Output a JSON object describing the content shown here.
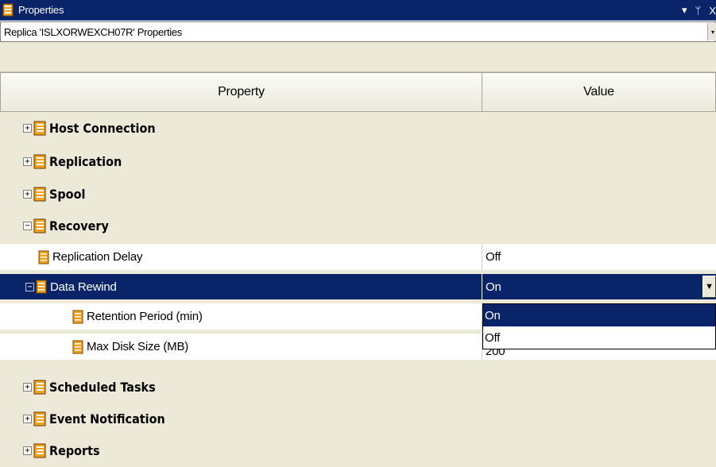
{
  "window": {
    "title": "Properties",
    "controls": {
      "dropdown": "▾",
      "pin": "ᛘ",
      "close": "X"
    }
  },
  "object_selector": {
    "value": "Replica  'ISLXORWEXCH07R' Properties",
    "arrow": "▾"
  },
  "grid": {
    "headers": {
      "property": "Property",
      "value": "Value"
    },
    "categories_top": [
      {
        "label": "Host Connection",
        "expander": "+"
      },
      {
        "label": "Replication",
        "expander": "+"
      },
      {
        "label": "Spool",
        "expander": "+"
      },
      {
        "label": "Recovery",
        "expander": "−"
      }
    ],
    "recovery_items": {
      "replication_delay": {
        "name": "Replication Delay",
        "value": "Off"
      },
      "data_rewind": {
        "name": "Data Rewind",
        "value": "On",
        "expander": "−",
        "dropdown_arrow": "▼"
      },
      "retention_period": {
        "name": "Retention Period (min)",
        "value": ""
      },
      "max_disk_size": {
        "name": "Max Disk Size (MB)",
        "value": "200"
      }
    },
    "categories_bottom": [
      {
        "label": "Scheduled Tasks",
        "expander": "+"
      },
      {
        "label": "Event Notification",
        "expander": "+"
      },
      {
        "label": "Reports",
        "expander": "+"
      }
    ]
  },
  "dropdown_list": {
    "options": [
      "On",
      "Off"
    ],
    "highlighted": "On"
  },
  "colors": {
    "selection": "#0a246a",
    "category_bg": "#ece9d8",
    "icon_orange": "#f0a020"
  }
}
